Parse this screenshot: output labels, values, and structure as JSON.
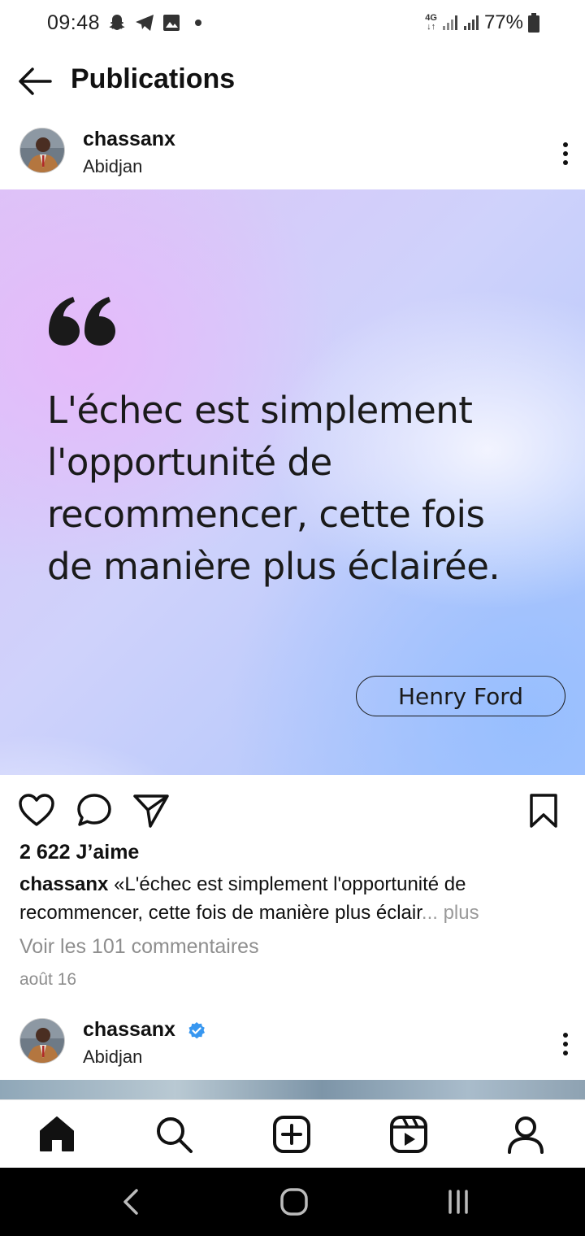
{
  "status_bar": {
    "time": "09:48",
    "left_icons": [
      "snapchat-icon",
      "telegram-icon",
      "gallery-icon",
      "notification-dot"
    ],
    "network": "4G",
    "battery_percent": "77%"
  },
  "header": {
    "title": "Publications",
    "back_icon": "arrow-left-icon"
  },
  "post": {
    "username": "chassanx",
    "location": "Abidjan",
    "image": {
      "quote": "L'échec est simplement l'opportunité de recommencer, cette fois de manière plus éclairée.",
      "author": "Henry Ford"
    },
    "likes": "2 622 J’aime",
    "caption_user": "chassanx",
    "caption_text": "«L'échec est simplement l'opportunité de recommencer, cette fois de manière plus éclair",
    "caption_more": "... plus",
    "comments_link": "Voir les 101 commentaires",
    "date": "août 16"
  },
  "next_post": {
    "username": "chassanx",
    "location": "Abidjan",
    "verified": true
  },
  "bottom_nav": [
    "home-icon",
    "search-icon",
    "create-icon",
    "reels-icon",
    "profile-icon"
  ],
  "colors": {
    "text": "#111111",
    "muted": "#8e8e8e",
    "verified": "#3897f0",
    "system_nav": "#000000"
  }
}
